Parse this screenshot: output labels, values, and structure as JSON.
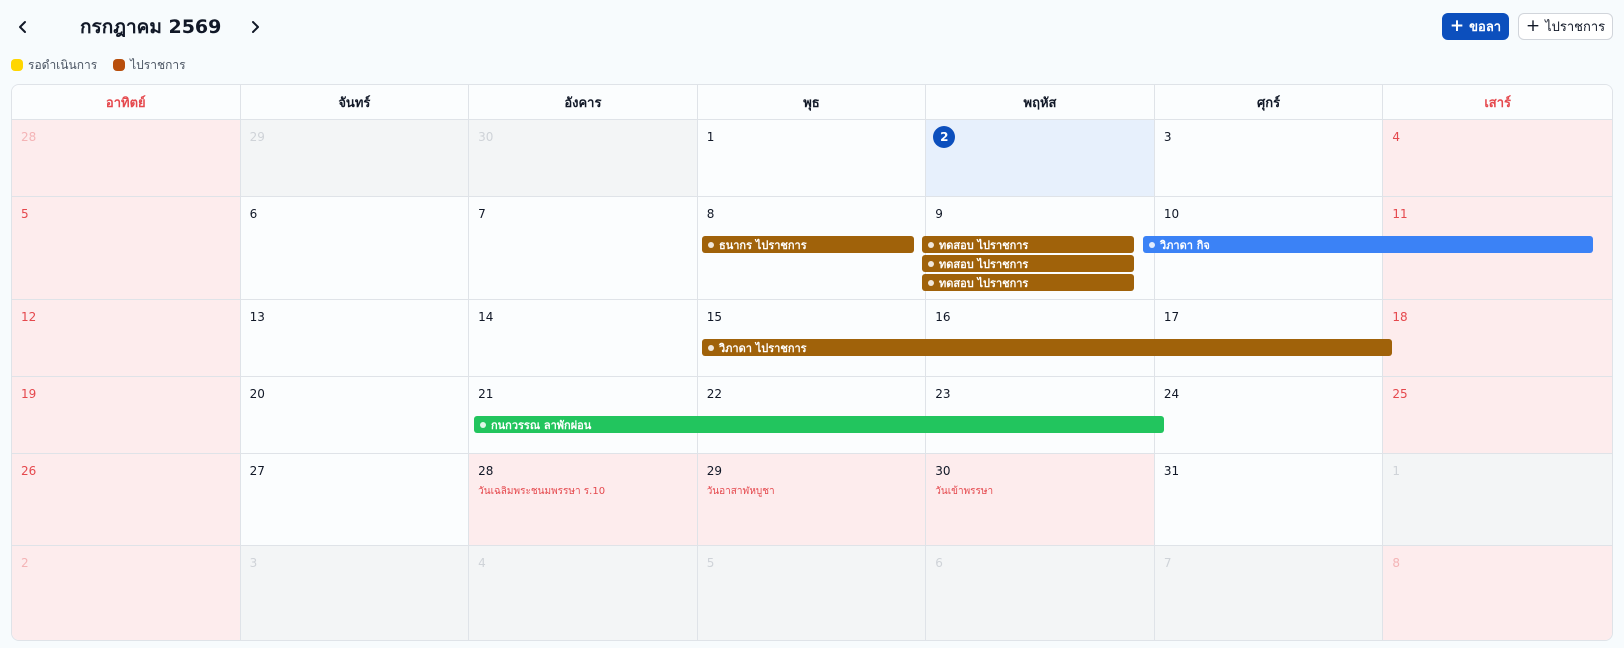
{
  "header": {
    "month_title": "กรกฎาคม 2569",
    "prev_icon": "chevron-left-icon",
    "next_icon": "chevron-right-icon",
    "leave_button_label": "ขอลา",
    "official_button_label": "ไปราชการ"
  },
  "legend": [
    {
      "label": "รอดำเนินการ",
      "color": "#ffd600"
    },
    {
      "label": "ไปราชการ",
      "color": "#b84e0c"
    }
  ],
  "weekdays": [
    "อาทิตย์",
    "จันทร์",
    "อังคาร",
    "พุธ",
    "พฤหัส",
    "ศุกร์",
    "เสาร์"
  ],
  "weeks": [
    {
      "days": [
        "28",
        "29",
        "30",
        "1",
        "2",
        "3",
        "4"
      ]
    },
    {
      "days": [
        "5",
        "6",
        "7",
        "8",
        "9",
        "10",
        "11"
      ]
    },
    {
      "days": [
        "12",
        "13",
        "14",
        "15",
        "16",
        "17",
        "18"
      ]
    },
    {
      "days": [
        "19",
        "20",
        "21",
        "22",
        "23",
        "24",
        "25"
      ]
    },
    {
      "days": [
        "26",
        "27",
        "28",
        "29",
        "30",
        "31",
        "1"
      ]
    },
    {
      "days": [
        "2",
        "3",
        "4",
        "5",
        "6",
        "7",
        "8"
      ]
    }
  ],
  "today": "2",
  "holidays": [
    {
      "day": "28",
      "name": "วันเฉลิมพระชนมพรรษา ร.10"
    },
    {
      "day": "29",
      "name": "วันอาสาฬหบูชา"
    },
    {
      "day": "30",
      "name": "วันเข้าพรรษา"
    }
  ],
  "events": [
    {
      "label": "ธนากร ไปราชการ",
      "color": "#a0620a"
    },
    {
      "label": "ทดสอบ ไปราชการ",
      "color": "#a0620a"
    },
    {
      "label": "ทดสอบ ไปราชการ",
      "color": "#a0620a"
    },
    {
      "label": "ทดสอบ ไปราชการ",
      "color": "#a0620a"
    },
    {
      "label": "วิภาดา กิจ",
      "color": "#3b82f6"
    },
    {
      "label": "วิภาดา ไปราชการ",
      "color": "#a0620a"
    },
    {
      "label": "กนกวรรณ ลาพักผ่อน",
      "color": "#22c55e"
    }
  ],
  "colors": {
    "accent": "#0c4fbd",
    "weekend_text": "#e5484d"
  }
}
